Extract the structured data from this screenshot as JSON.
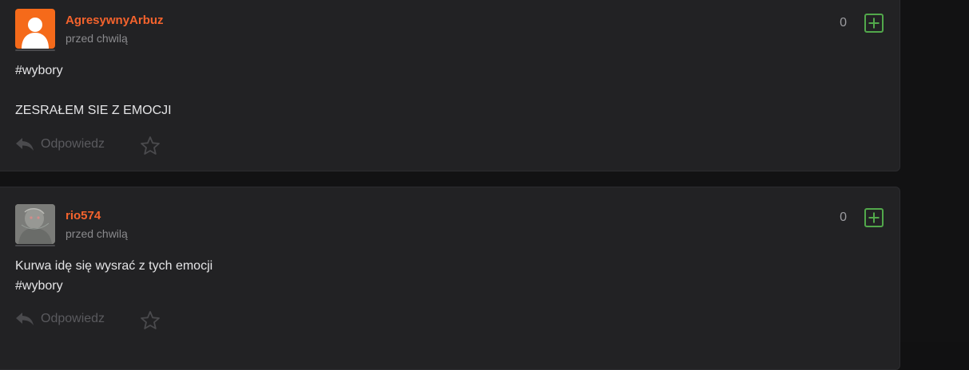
{
  "colors": {
    "page_background": "#121213",
    "card_background": "#222224",
    "username": "#f4632d",
    "plus_green": "#52a84b"
  },
  "posts": [
    {
      "username": "AgresywnyArbuz",
      "timestamp": "przed chwilą",
      "body": "#wybory\n\nZESRAŁEM SIE Z EMOCJI",
      "votes": "0",
      "avatar": "default-user-icon",
      "reply_label": "Odpowiedz"
    },
    {
      "username": "rio574",
      "timestamp": "przed chwilą",
      "body": "Kurwa idę się wysrać z tych emocji\n#wybory",
      "votes": "0",
      "avatar": "user-photo",
      "reply_label": "Odpowiedz"
    }
  ]
}
